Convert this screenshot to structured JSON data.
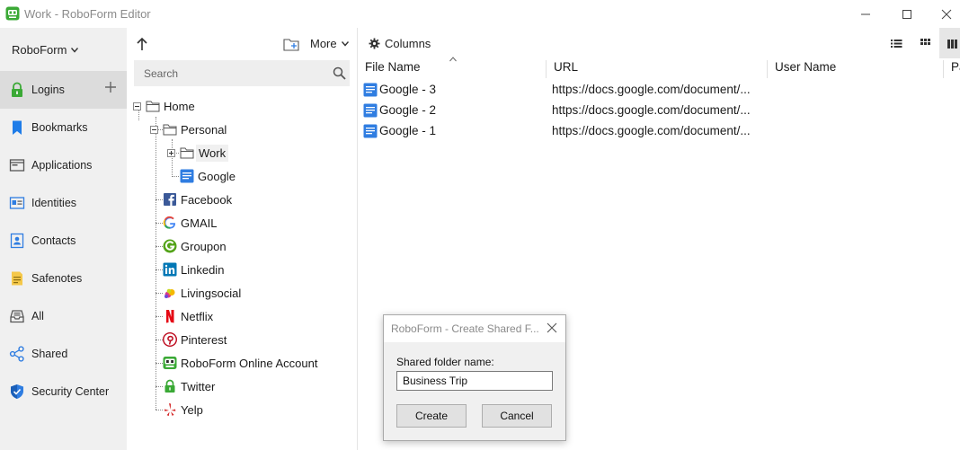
{
  "window": {
    "title": "Work - RoboForm Editor",
    "controls": [
      "minimize",
      "maximize",
      "close"
    ]
  },
  "sidebar": {
    "brand_label": "RoboForm",
    "items": [
      {
        "label": "Logins",
        "icon": "lock-icon",
        "active": true
      },
      {
        "label": "Bookmarks",
        "icon": "bookmark-icon"
      },
      {
        "label": "Applications",
        "icon": "application-icon"
      },
      {
        "label": "Identities",
        "icon": "identity-card-icon"
      },
      {
        "label": "Contacts",
        "icon": "contact-card-icon"
      },
      {
        "label": "Safenotes",
        "icon": "note-icon"
      },
      {
        "label": "All",
        "icon": "inbox-icon"
      },
      {
        "label": "Shared",
        "icon": "share-icon"
      },
      {
        "label": "Security Center",
        "icon": "shield-icon"
      }
    ]
  },
  "tree_pane": {
    "more_label": "More",
    "search_placeholder": "Search",
    "nodes": [
      {
        "label": "Home",
        "icon": "folder-icon"
      },
      {
        "label": "Personal",
        "icon": "folder-icon"
      },
      {
        "label": "Work",
        "icon": "folder-icon",
        "selected": true
      },
      {
        "label": "Google",
        "icon": "document-icon"
      },
      {
        "label": "Facebook",
        "icon": "facebook-icon"
      },
      {
        "label": "GMAIL",
        "icon": "google-icon"
      },
      {
        "label": "Groupon",
        "icon": "groupon-icon"
      },
      {
        "label": "Linkedin",
        "icon": "linkedin-icon"
      },
      {
        "label": "Livingsocial",
        "icon": "livingsocial-icon"
      },
      {
        "label": "Netflix",
        "icon": "netflix-icon"
      },
      {
        "label": "Pinterest",
        "icon": "pinterest-icon"
      },
      {
        "label": "RoboForm Online Account",
        "icon": "roboform-icon"
      },
      {
        "label": "Twitter",
        "icon": "lock-icon"
      },
      {
        "label": "Yelp",
        "icon": "yelp-icon"
      }
    ]
  },
  "list_pane": {
    "columns_label": "Columns",
    "headers": [
      "File Name",
      "URL",
      "User Name",
      "Pa"
    ],
    "rows": [
      {
        "name": "Google - 3",
        "url": "https://docs.google.com/document/..."
      },
      {
        "name": "Google - 2",
        "url": "https://docs.google.com/document/..."
      },
      {
        "name": "Google - 1",
        "url": "https://docs.google.com/document/..."
      }
    ]
  },
  "dialog": {
    "title": "RoboForm - Create Shared F...",
    "field_label": "Shared folder name:",
    "field_value": "Business Trip",
    "create_label": "Create",
    "cancel_label": "Cancel"
  },
  "colors": {
    "brand_green": "#3aa935",
    "doc_blue": "#2f7de1",
    "sidebar_bg": "#f0f0f0",
    "active_item_bg": "#dcdcdc"
  }
}
